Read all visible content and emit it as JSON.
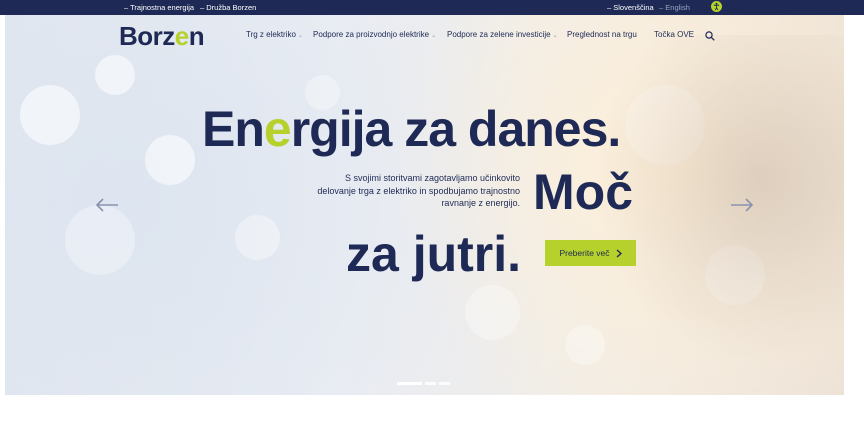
{
  "topbar": {
    "links": [
      "Trajnostna energija",
      "Družba Borzen"
    ],
    "languages": [
      "Slovenščina",
      "English"
    ],
    "accessibility": "accessibility-icon"
  },
  "header": {
    "logo_text": "Borzen",
    "nav": [
      {
        "label": "Trg z elektriko",
        "has_dropdown": true
      },
      {
        "label": "Podpore za proizvodnjo elektrike",
        "has_dropdown": true
      },
      {
        "label": "Podpore za zelene investicije",
        "has_dropdown": true
      },
      {
        "label": "Preglednost na trgu",
        "has_dropdown": false
      },
      {
        "label": "Točka OVE",
        "has_dropdown": false
      }
    ],
    "search_icon": "search-icon"
  },
  "hero": {
    "headline_1_prefix": "En",
    "headline_1_accent": "e",
    "headline_1_suffix": "rgija za danes.",
    "headline_2": "Moč",
    "headline_3": "za jutri.",
    "description": "S svojimi storitvami zagotavljamo učinkovito delovanje trga z elektriko in spodbujamo trajnostno ravnanje z energijo.",
    "cta_label": "Preberite več",
    "slides": 3,
    "active_slide": 1
  },
  "colors": {
    "brand_navy": "#1e2a55",
    "brand_green": "#b7d12c"
  }
}
